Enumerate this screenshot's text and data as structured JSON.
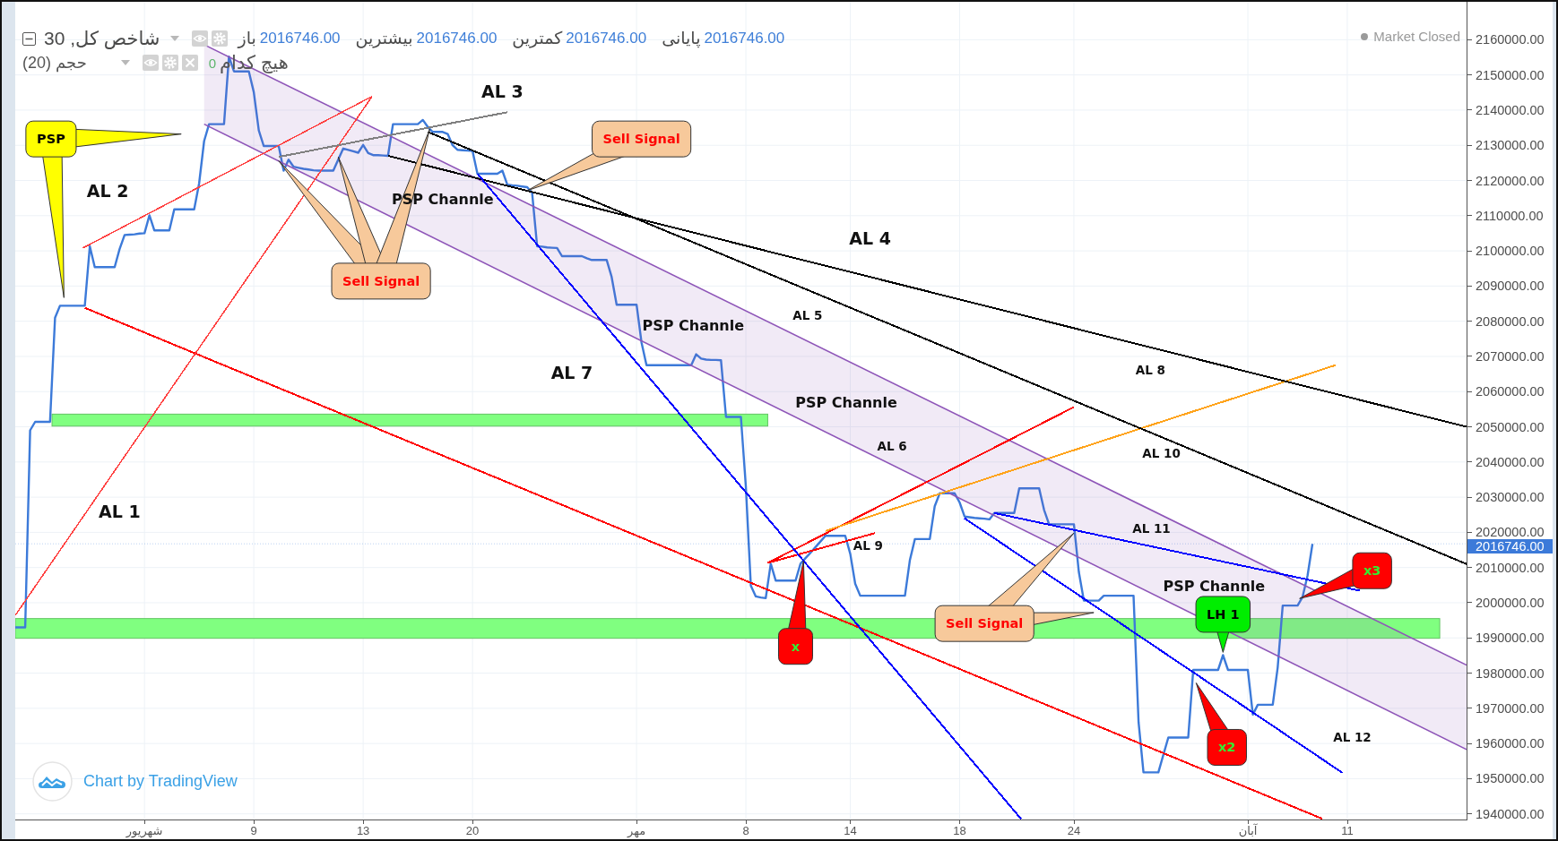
{
  "legend": {
    "main": {
      "title": "شاخص کل, 30",
      "ohlc": {
        "open": {
          "label": "باز",
          "value": "2016746.00"
        },
        "high": {
          "label": "بیشترین",
          "value": "2016746.00"
        },
        "low": {
          "label": "کمترین",
          "value": "2016746.00"
        },
        "close": {
          "label": "پایانی",
          "value": "2016746.00"
        }
      }
    },
    "volume": {
      "title": "حجم (20)",
      "value": "0",
      "label": "هیچ کدام"
    }
  },
  "market_status": "Market Closed",
  "chart": {
    "chart_data": {
      "type": "line",
      "grid": true,
      "categories": [
        null,
        null,
        null,
        null,
        null,
        null,
        null,
        null,
        null,
        null,
        null,
        null,
        null,
        null,
        null,
        null,
        null,
        null,
        null,
        null,
        null,
        null,
        null,
        null,
        null,
        null,
        "شهریور",
        null,
        null,
        null,
        null,
        null,
        null,
        null,
        null,
        null,
        null,
        null,
        null,
        null,
        null,
        null,
        null,
        null,
        null,
        null,
        null,
        null,
        "9",
        null,
        null,
        null,
        null,
        null,
        null,
        null,
        null,
        null,
        null,
        null,
        null,
        null,
        null,
        null,
        null,
        null,
        null,
        null,
        null,
        null,
        "13",
        null,
        null,
        null,
        null,
        null,
        null,
        null,
        null,
        null,
        null,
        null,
        null,
        null,
        null,
        null,
        null,
        null,
        null,
        null,
        null,
        null,
        "20",
        null,
        null,
        null,
        null,
        null,
        null,
        null,
        null,
        null,
        null,
        null,
        null,
        null,
        null,
        null,
        null,
        null,
        null,
        null,
        null,
        null,
        null,
        null,
        null,
        null,
        null,
        null,
        null,
        null,
        null,
        null,
        null,
        "مهر",
        null,
        null,
        null,
        null,
        null,
        null,
        null,
        null,
        null,
        null,
        null,
        null,
        null,
        null,
        null,
        null,
        null,
        null,
        null,
        null,
        null,
        "8",
        null,
        null,
        null,
        null,
        null,
        null,
        null,
        null,
        null,
        null,
        null,
        null,
        null,
        null,
        null,
        null,
        null,
        null,
        null,
        null,
        "14",
        null,
        null,
        null,
        null,
        null,
        null,
        null,
        null,
        null,
        null,
        null,
        null,
        null,
        null,
        null,
        null,
        null,
        null,
        null,
        null,
        null,
        "18",
        null,
        null,
        null,
        null,
        null,
        null,
        null,
        null,
        null,
        null,
        null,
        null,
        null,
        null,
        null,
        null,
        null,
        null,
        null,
        null,
        null,
        null,
        "24",
        null,
        null,
        null,
        null,
        null,
        null,
        null,
        null,
        null,
        null,
        null,
        null,
        null,
        null,
        null,
        null,
        null,
        null,
        null,
        null,
        null,
        null,
        null,
        null,
        null,
        null,
        null,
        null,
        null,
        null,
        null,
        null,
        null,
        null,
        "آبان",
        null,
        null,
        null,
        null,
        null,
        null,
        null,
        null,
        null,
        null,
        null,
        null,
        null,
        null,
        null,
        null,
        null,
        null,
        null,
        "11",
        null,
        null,
        null,
        null,
        null,
        null,
        null,
        null,
        null,
        null,
        null,
        null,
        null,
        null,
        null,
        null,
        null,
        null,
        null,
        null,
        null,
        null,
        null,
        null
      ],
      "series": [
        {
          "color": "#3c7ad9",
          "values": [
            1993000,
            1993000,
            1993000,
            2049000,
            2051400,
            2051400,
            2051400,
            2051400,
            2081000,
            2084400,
            2084400,
            2084400,
            2084400,
            2084400,
            2084400,
            2101300,
            2095400,
            2095400,
            2095400,
            2095400,
            2095400,
            2100500,
            2104500,
            2104600,
            2104700,
            2104900,
            2105000,
            2110100,
            2105800,
            2105800,
            2105800,
            2105800,
            2111800,
            2111800,
            2111800,
            2111800,
            2111800,
            2119100,
            2131200,
            2136000,
            2136000,
            2136000,
            2136000,
            2155200,
            2151000,
            2151000,
            2151000,
            2151000,
            2145100,
            2134200,
            2129800,
            2129800,
            2129800,
            2129800,
            2122800,
            2125900,
            2123900,
            2123600,
            2123300,
            2123100,
            2122900,
            2122800,
            2122800,
            2122800,
            2122800,
            2126000,
            2129100,
            2128700,
            2128300,
            2127900,
            2130100,
            2127800,
            2127200,
            2127200,
            2127100,
            2127000,
            2136000,
            2136000,
            2136000,
            2136000,
            2136000,
            2136000,
            2137200,
            2135200,
            2133800,
            2133800,
            2133800,
            2133200,
            2130000,
            2128700,
            2128600,
            2128500,
            2128400,
            2121900,
            2121900,
            2121900,
            2121900,
            2121900,
            2122800,
            2118800,
            2118600,
            2118500,
            2118300,
            2118100,
            2116500,
            2101300,
            2101200,
            2101000,
            2100900,
            2100800,
            2098500,
            2098500,
            2098500,
            2098500,
            2098500,
            2097900,
            2097400,
            2097400,
            2097400,
            2097400,
            2092600,
            2084700,
            2084700,
            2084700,
            2084700,
            2084700,
            2074000,
            2067500,
            2067500,
            2067500,
            2067500,
            2067500,
            2067500,
            2067500,
            2067500,
            2067500,
            2067500,
            2070600,
            2069400,
            2069100,
            2069000,
            2069000,
            2068900,
            2052800,
            2052800,
            2052800,
            2052800,
            2033100,
            2004800,
            2001800,
            2001500,
            2001300,
            2011100,
            2006300,
            2006300,
            2006300,
            2006300,
            2006300,
            2011100,
            2012700,
            2014200,
            2015800,
            2017400,
            2019000,
            2019000,
            2019000,
            2019000,
            2019000,
            2013900,
            2005400,
            2002000,
            2002000,
            2002000,
            2002000,
            2002000,
            2002000,
            2002000,
            2002000,
            2002000,
            2002000,
            2012100,
            2018100,
            2018100,
            2018100,
            2018100,
            2027400,
            2031100,
            2031100,
            2031100,
            2031100,
            2028500,
            2024500,
            2024300,
            2024100,
            2024000,
            2023900,
            2023700,
            2025500,
            2025500,
            2025500,
            2025500,
            2025500,
            2032500,
            2032500,
            2032500,
            2032500,
            2032500,
            2026400,
            2022300,
            2022300,
            2022300,
            2022300,
            2022300,
            2022300,
            2008700,
            2000600,
            2000600,
            2000600,
            2000600,
            2002000,
            2002000,
            2002000,
            2002000,
            2002000,
            2002000,
            2002000,
            1966100,
            1951800,
            1951800,
            1951800,
            1951800,
            1956800,
            1961700,
            1961700,
            1961700,
            1961700,
            1961700,
            1980900,
            1980900,
            1980900,
            1980900,
            1980900,
            1980900,
            1985100,
            1980900,
            1980900,
            1980900,
            1980900,
            1980900,
            1968200,
            1971000,
            1971000,
            1971000,
            1971000,
            1981600,
            1999200,
            1999200,
            1999200,
            1999200,
            2001600,
            2007700,
            2016746,
            null,
            null,
            null,
            null,
            null,
            null,
            null,
            null,
            null,
            null,
            null,
            null,
            null,
            null,
            null,
            null,
            null,
            null,
            null,
            null,
            null,
            null,
            null,
            null,
            null,
            null,
            null,
            null,
            null,
            null,
            null
          ]
        }
      ],
      "ylim": [
        1938400,
        2170780
      ],
      "yticks": [
        {
          "value": 2160000,
          "label": "2160000.00"
        },
        {
          "value": 2150000,
          "label": "2150000.00"
        },
        {
          "value": 2140000,
          "label": "2140000.00"
        },
        {
          "value": 2130000,
          "label": "2130000.00"
        },
        {
          "value": 2120000,
          "label": "2120000.00"
        },
        {
          "value": 2110000,
          "label": "2110000.00"
        },
        {
          "value": 2100000,
          "label": "2100000.00"
        },
        {
          "value": 2090000,
          "label": "2090000.00"
        },
        {
          "value": 2080000,
          "label": "2080000.00"
        },
        {
          "value": 2070000,
          "label": "2070000.00"
        },
        {
          "value": 2060000,
          "label": "2060000.00"
        },
        {
          "value": 2050000,
          "label": "2050000.00"
        },
        {
          "value": 2040000,
          "label": "2040000.00"
        },
        {
          "value": 2030000,
          "label": "2030000.00"
        },
        {
          "value": 2020000,
          "label": "2020000.00"
        },
        {
          "value": 2010000,
          "label": "2010000.00"
        },
        {
          "value": 2000000,
          "label": "2000000.00"
        },
        {
          "value": 1990000,
          "label": "1990000.00"
        },
        {
          "value": 1980000,
          "label": "1980000.00"
        },
        {
          "value": 1970000,
          "label": "1970000.00"
        },
        {
          "value": 1960000,
          "label": "1960000.00"
        },
        {
          "value": 1950000,
          "label": "1950000.00"
        },
        {
          "value": 1940000,
          "label": "1940000.00"
        }
      ]
    },
    "last_price": "2016746.00",
    "drawings": [
      {
        "kind": "zone",
        "color": "#80ff80"
      },
      {
        "kind": "zone",
        "color": "#80ff80"
      },
      {
        "kind": "channel",
        "color": "#8e55b8"
      },
      {
        "kind": "trend_line",
        "color": "#ff0000"
      },
      {
        "kind": "thin_line",
        "color": "#ff4040"
      },
      {
        "kind": "thin_line",
        "color": "#ff4040"
      },
      {
        "kind": "trend_line",
        "color": "#ff0000"
      },
      {
        "kind": "trend_line",
        "color": "#ff0000"
      },
      {
        "kind": "trend_line",
        "color": "#ffa31a"
      },
      {
        "kind": "trend_line",
        "color": "#000000"
      },
      {
        "kind": "trend_line",
        "color": "#000000"
      },
      {
        "kind": "trend_line",
        "color": "#808080"
      },
      {
        "kind": "trend_line",
        "color": "#0000ff"
      },
      {
        "kind": "trend_line",
        "color": "#0000ff"
      },
      {
        "kind": "trend_line",
        "color": "#0000ff"
      }
    ],
    "callouts": [
      {
        "kind": "note",
        "text": "PSP",
        "color": "#ffff00"
      },
      {
        "kind": "signal",
        "text": "Sell Signal",
        "color": "#f7c99b"
      },
      {
        "kind": "signal",
        "text": "Sell Signal",
        "color": "#f7c99b"
      },
      {
        "kind": "signal",
        "text": "Sell Signal",
        "color": "#f7c99b"
      },
      {
        "kind": "mark",
        "text": "x",
        "color": "#ff0000"
      },
      {
        "kind": "mark",
        "text": "x2",
        "color": "#ff0000"
      },
      {
        "kind": "mark",
        "text": "x3",
        "color": "#ff0000"
      },
      {
        "kind": "note",
        "text": "LH 1",
        "color": "#00ee00"
      }
    ],
    "labels": [
      {
        "kind": "big",
        "text": "AL 3"
      },
      {
        "kind": "big",
        "text": "AL 2"
      },
      {
        "kind": "medium",
        "text": "PSP Channle"
      },
      {
        "kind": "big",
        "text": "AL 4"
      },
      {
        "kind": "small",
        "text": "AL 5"
      },
      {
        "kind": "medium",
        "text": "PSP Channle"
      },
      {
        "kind": "big",
        "text": "AL 7"
      },
      {
        "kind": "small",
        "text": "AL 8"
      },
      {
        "kind": "medium",
        "text": "PSP Channle"
      },
      {
        "kind": "small",
        "text": "AL 6"
      },
      {
        "kind": "small",
        "text": "AL 10"
      },
      {
        "kind": "big",
        "text": "AL 1"
      },
      {
        "kind": "small",
        "text": "AL 11"
      },
      {
        "kind": "small",
        "text": "AL 9"
      },
      {
        "kind": "medium",
        "text": "PSP Channle"
      },
      {
        "kind": "small",
        "text": "AL 12"
      }
    ]
  },
  "attribution": "Chart by TradingView"
}
